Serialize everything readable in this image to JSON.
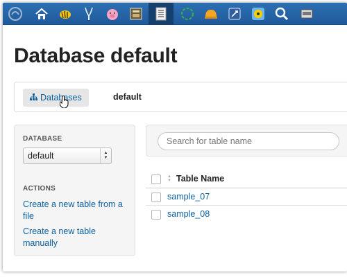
{
  "app_bar": {
    "icons": [
      "hue-logo-icon",
      "home-icon",
      "hive-bee-icon",
      "antelope-icon",
      "pig-icon",
      "file-browser-icon",
      "metastore-table-icon",
      "job-browser-icon",
      "hard-hat-icon",
      "oozie-icon",
      "target-icon",
      "search-icon",
      "extra-app-icon"
    ],
    "active_icon": "metastore-table-icon",
    "colors": {
      "bar": "#2d6fb3",
      "active": "#163f6d"
    }
  },
  "page": {
    "title": "Database default"
  },
  "breadcrumb": {
    "databases_label": "Databases",
    "current": "default"
  },
  "sidebar": {
    "database_heading": "DATABASE",
    "selected_database": "default",
    "actions_heading": "ACTIONS",
    "actions": [
      "Create a new table from a file",
      "Create a new table manually"
    ]
  },
  "main": {
    "search": {
      "placeholder": "Search for table name",
      "value": ""
    },
    "table": {
      "column_header": "Table Name",
      "rows": [
        "sample_07",
        "sample_08"
      ]
    }
  },
  "colors": {
    "link": "#0b5f9e",
    "panel": "#f5f5f5"
  }
}
